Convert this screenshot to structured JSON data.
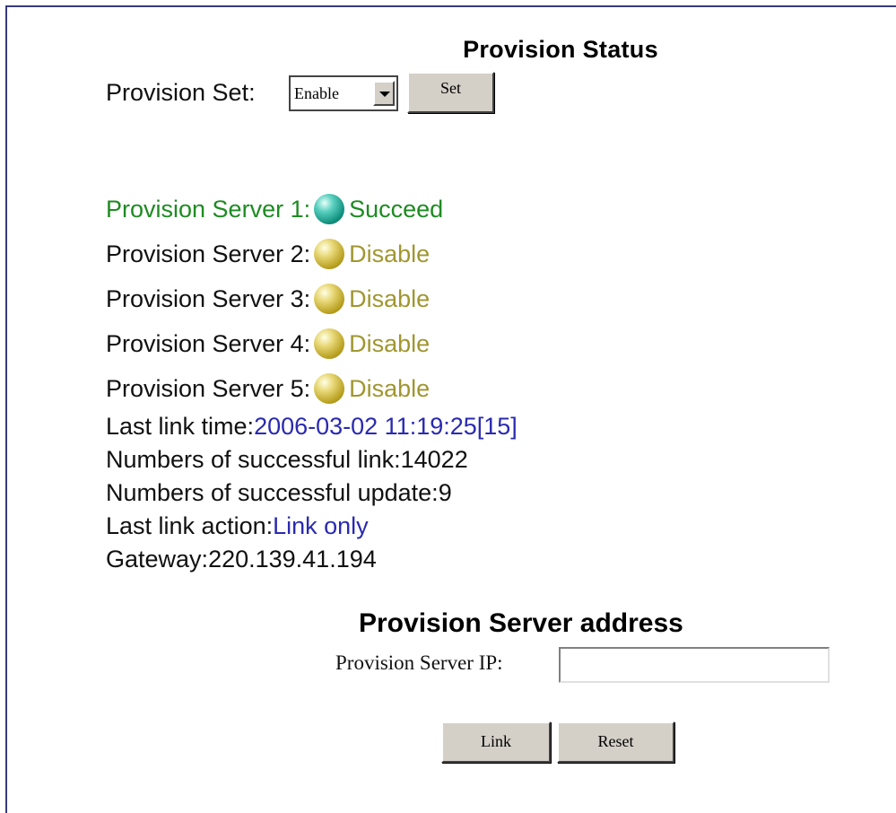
{
  "page": {
    "title": "Provision Status"
  },
  "provision_set": {
    "label": "Provision Set:",
    "selected": "Enable",
    "set_button": "Set"
  },
  "servers": [
    {
      "label": "Provision Server 1:",
      "status": "Succeed",
      "state": "success",
      "indicator_color": "#1e8b22"
    },
    {
      "label": "Provision Server 2:",
      "status": "Disable",
      "state": "disabled",
      "indicator_color": "#a09630"
    },
    {
      "label": "Provision Server 3:",
      "status": "Disable",
      "state": "disabled",
      "indicator_color": "#a09630"
    },
    {
      "label": "Provision Server 4:",
      "status": "Disable",
      "state": "disabled",
      "indicator_color": "#a09630"
    },
    {
      "label": "Provision Server 5:",
      "status": "Disable",
      "state": "disabled",
      "indicator_color": "#a09630"
    }
  ],
  "info": {
    "last_link_time_label": "Last link time:",
    "last_link_time_value": "2006-03-02 11:19:25[15]",
    "successful_link_label": "Numbers of successful link:",
    "successful_link_value": "14022",
    "successful_update_label": "Numbers of successful update:",
    "successful_update_value": "9",
    "last_link_action_label": "Last link action:",
    "last_link_action_value": "Link only",
    "gateway_label": "Gateway:",
    "gateway_value": "220.139.41.194"
  },
  "server_address": {
    "title": "Provision Server address",
    "ip_label": "Provision Server IP:",
    "ip_value": "",
    "link_button": "Link",
    "reset_button": "Reset"
  },
  "colors": {
    "success": "#1e8b22",
    "disabled": "#a09630",
    "value_blue": "#2a2ab0",
    "frame": "#3a3a7a"
  }
}
